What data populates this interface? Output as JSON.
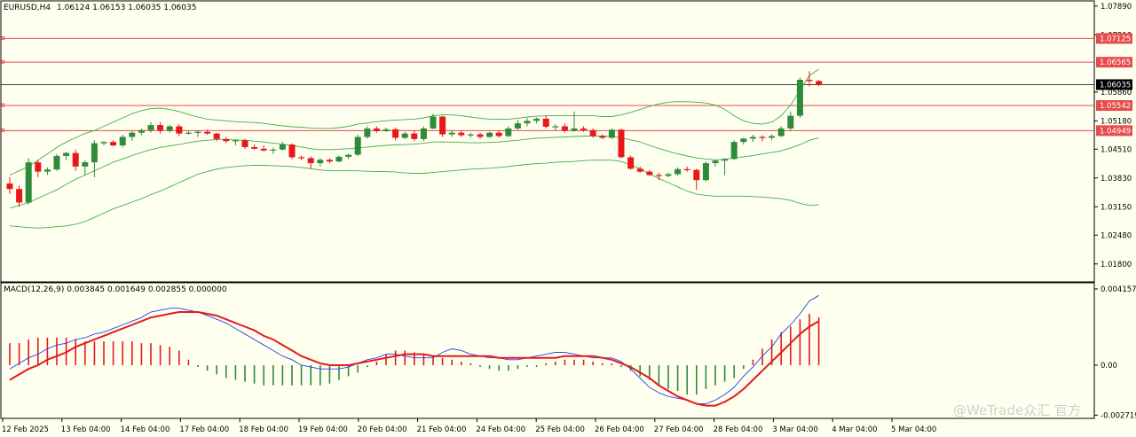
{
  "chart_data": {
    "type": "candlestick",
    "symbol": "EURUSD,H4",
    "ohlc_header": "1.06124 1.06153 1.06035 1.06035",
    "price_axis": {
      "ylim": [
        1.0146,
        1.0795
      ],
      "ticks": [
        "1.07890",
        "1.07210",
        "1.05860",
        "1.05180",
        "1.04510",
        "1.03830",
        "1.03150",
        "1.02480",
        "1.01800"
      ]
    },
    "current_price": "1.06035",
    "levels": [
      {
        "label": "1.07125",
        "value": 1.07125
      },
      {
        "label": "1.06565",
        "value": 1.06565
      },
      {
        "label": "1.05542",
        "value": 1.05542
      },
      {
        "label": "1.04949",
        "value": 1.04949
      }
    ],
    "time_labels": [
      "12 Feb 2025",
      "13 Feb 04:00",
      "14 Feb 04:00",
      "17 Feb 04:00",
      "18 Feb 04:00",
      "19 Feb 04:00",
      "20 Feb 04:00",
      "21 Feb 04:00",
      "24 Feb 04:00",
      "25 Feb 04:00",
      "26 Feb 04:00",
      "27 Feb 04:00",
      "28 Feb 04:00",
      "3 Mar 04:00",
      "4 Mar 04:00",
      "5 Mar 04:00"
    ],
    "candles": [
      [
        1.037,
        1.0385,
        1.0345,
        1.0357
      ],
      [
        1.0357,
        1.0365,
        1.0315,
        1.0325
      ],
      [
        1.0325,
        1.043,
        1.032,
        1.042
      ],
      [
        1.042,
        1.0425,
        1.0385,
        1.0398
      ],
      [
        1.0398,
        1.0408,
        1.039,
        1.0403
      ],
      [
        1.0403,
        1.044,
        1.04,
        1.0435
      ],
      [
        1.0435,
        1.0445,
        1.0425,
        1.0442
      ],
      [
        1.0442,
        1.045,
        1.04,
        1.041
      ],
      [
        1.041,
        1.0425,
        1.039,
        1.042
      ],
      [
        1.042,
        1.0472,
        1.0385,
        1.0465
      ],
      [
        1.0465,
        1.047,
        1.046,
        1.0468
      ],
      [
        1.0468,
        1.0472,
        1.0458,
        1.046
      ],
      [
        1.046,
        1.0485,
        1.0455,
        1.048
      ],
      [
        1.048,
        1.0495,
        1.047,
        1.049
      ],
      [
        1.049,
        1.05,
        1.0484,
        1.0496
      ],
      [
        1.0496,
        1.0515,
        1.049,
        1.0508
      ],
      [
        1.0508,
        1.0515,
        1.0488,
        1.0495
      ],
      [
        1.0495,
        1.0508,
        1.049,
        1.0505
      ],
      [
        1.0505,
        1.051,
        1.0482,
        1.0488
      ],
      [
        1.0488,
        1.0495,
        1.0485,
        1.049
      ],
      [
        1.049,
        1.0496,
        1.048,
        1.0492
      ],
      [
        1.0492,
        1.0497,
        1.0485,
        1.0488
      ],
      [
        1.0488,
        1.049,
        1.047,
        1.0475
      ],
      [
        1.0475,
        1.048,
        1.0465,
        1.047
      ],
      [
        1.047,
        1.0474,
        1.046,
        1.0472
      ],
      [
        1.0472,
        1.0476,
        1.0452,
        1.0456
      ],
      [
        1.0456,
        1.0462,
        1.045,
        1.0452
      ],
      [
        1.0452,
        1.046,
        1.0445,
        1.0448
      ],
      [
        1.0448,
        1.0455,
        1.044,
        1.045
      ],
      [
        1.045,
        1.0468,
        1.0448,
        1.0462
      ],
      [
        1.0462,
        1.0465,
        1.0428,
        1.0432
      ],
      [
        1.0432,
        1.0436,
        1.0425,
        1.043
      ],
      [
        1.043,
        1.0434,
        1.0405,
        1.0418
      ],
      [
        1.0418,
        1.043,
        1.041,
        1.0426
      ],
      [
        1.0426,
        1.043,
        1.0418,
        1.0422
      ],
      [
        1.0422,
        1.0436,
        1.042,
        1.0433
      ],
      [
        1.0433,
        1.044,
        1.0428,
        1.0438
      ],
      [
        1.0438,
        1.0485,
        1.0435,
        1.048
      ],
      [
        1.048,
        1.0505,
        1.0476,
        1.05
      ],
      [
        1.05,
        1.0505,
        1.049,
        1.0494
      ],
      [
        1.0494,
        1.0502,
        1.0492,
        1.0498
      ],
      [
        1.0498,
        1.0502,
        1.0472,
        1.0478
      ],
      [
        1.0478,
        1.0492,
        1.0475,
        1.0488
      ],
      [
        1.0488,
        1.0495,
        1.047,
        1.0475
      ],
      [
        1.0475,
        1.0505,
        1.047,
        1.05
      ],
      [
        1.05,
        1.0535,
        1.0498,
        1.0528
      ],
      [
        1.0528,
        1.053,
        1.048,
        1.0486
      ],
      [
        1.0486,
        1.0496,
        1.048,
        1.049
      ],
      [
        1.049,
        1.0494,
        1.048,
        1.0484
      ],
      [
        1.0484,
        1.049,
        1.0478,
        1.0486
      ],
      [
        1.0486,
        1.049,
        1.0475,
        1.048
      ],
      [
        1.048,
        1.0492,
        1.0478,
        1.049
      ],
      [
        1.049,
        1.0495,
        1.0478,
        1.0482
      ],
      [
        1.0482,
        1.0505,
        1.048,
        1.05
      ],
      [
        1.05,
        1.052,
        1.0496,
        1.0512
      ],
      [
        1.0512,
        1.0525,
        1.0505,
        1.0518
      ],
      [
        1.0518,
        1.0526,
        1.0512,
        1.0523
      ],
      [
        1.0523,
        1.053,
        1.05,
        1.0504
      ],
      [
        1.0504,
        1.051,
        1.0495,
        1.0505
      ],
      [
        1.0505,
        1.0512,
        1.049,
        1.0495
      ],
      [
        1.0495,
        1.054,
        1.0492,
        1.05
      ],
      [
        1.05,
        1.0505,
        1.0492,
        1.0496
      ],
      [
        1.0496,
        1.05,
        1.0478,
        1.0482
      ],
      [
        1.0482,
        1.0486,
        1.0475,
        1.0478
      ],
      [
        1.0478,
        1.05,
        1.0475,
        1.0497
      ],
      [
        1.0497,
        1.05,
        1.043,
        1.0432
      ],
      [
        1.0432,
        1.0436,
        1.0402,
        1.0405
      ],
      [
        1.0405,
        1.041,
        1.0395,
        1.0398
      ],
      [
        1.0398,
        1.0402,
        1.0388,
        1.039
      ],
      [
        1.039,
        1.0395,
        1.0378,
        1.0388
      ],
      [
        1.0388,
        1.0395,
        1.0385,
        1.0392
      ],
      [
        1.0392,
        1.0408,
        1.0388,
        1.0404
      ],
      [
        1.0404,
        1.041,
        1.0398,
        1.0402
      ],
      [
        1.0402,
        1.0405,
        1.0355,
        1.0378
      ],
      [
        1.0378,
        1.0422,
        1.0375,
        1.0418
      ],
      [
        1.0418,
        1.0425,
        1.041,
        1.0424
      ],
      [
        1.0424,
        1.043,
        1.039,
        1.0428
      ],
      [
        1.0428,
        1.0472,
        1.0425,
        1.0468
      ],
      [
        1.0468,
        1.0478,
        1.0462,
        1.0476
      ],
      [
        1.0476,
        1.0485,
        1.0468,
        1.048
      ],
      [
        1.048,
        1.0484,
        1.047,
        1.0478
      ],
      [
        1.0478,
        1.0486,
        1.0472,
        1.0482
      ],
      [
        1.0482,
        1.0505,
        1.048,
        1.05
      ],
      [
        1.05,
        1.054,
        1.0495,
        1.053
      ],
      [
        1.053,
        1.062,
        1.0525,
        1.0615
      ],
      [
        1.0615,
        1.0635,
        1.06,
        1.0612
      ],
      [
        1.0612,
        1.0615,
        1.06,
        1.0603
      ]
    ],
    "bollinger": {
      "upper": [
        1.039,
        1.04,
        1.041,
        1.0425,
        1.044,
        1.0455,
        1.0468,
        1.0478,
        1.0488,
        1.0495,
        1.0505,
        1.0515,
        1.0525,
        1.0535,
        1.0542,
        1.0547,
        1.0548,
        1.0545,
        1.054,
        1.0533,
        1.0527,
        1.0522,
        1.052,
        1.0518,
        1.0516,
        1.0515,
        1.0514,
        1.0512,
        1.0509,
        1.0506,
        1.0504,
        1.0503,
        1.0501,
        1.05,
        1.05,
        1.0502,
        1.0505,
        1.051,
        1.0513,
        1.0516,
        1.0518,
        1.052,
        1.0521,
        1.0522,
        1.0525,
        1.053,
        1.0532,
        1.0532,
        1.053,
        1.0527,
        1.0524,
        1.0522,
        1.0522,
        1.0522,
        1.0524,
        1.0527,
        1.0529,
        1.053,
        1.053,
        1.053,
        1.053,
        1.053,
        1.053,
        1.0528,
        1.0528,
        1.0532,
        1.0538,
        1.0545,
        1.0552,
        1.0558,
        1.0562,
        1.0563,
        1.0563,
        1.0562,
        1.056,
        1.0555,
        1.0545,
        1.053,
        1.0518,
        1.0512,
        1.051,
        1.0515,
        1.053,
        1.0555,
        1.059,
        1.0625,
        1.064
      ],
      "middle": [
        1.0312,
        1.0318,
        1.0325,
        1.0335,
        1.0345,
        1.0355,
        1.0368,
        1.038,
        1.039,
        1.04,
        1.041,
        1.042,
        1.0428,
        1.0436,
        1.0443,
        1.045,
        1.0455,
        1.0459,
        1.0462,
        1.0466,
        1.047,
        1.0472,
        1.0474,
        1.0474,
        1.0473,
        1.0472,
        1.047,
        1.0468,
        1.0465,
        1.0463,
        1.046,
        1.0456,
        1.0452,
        1.045,
        1.045,
        1.0451,
        1.0452,
        1.0454,
        1.0456,
        1.0458,
        1.046,
        1.0461,
        1.0462,
        1.0463,
        1.0465,
        1.0468,
        1.0468,
        1.0468,
        1.0467,
        1.0466,
        1.0466,
        1.0467,
        1.0468,
        1.047,
        1.0472,
        1.0475,
        1.0477,
        1.0478,
        1.0479,
        1.048,
        1.0481,
        1.0482,
        1.0482,
        1.0482,
        1.0481,
        1.0478,
        1.0473,
        1.0468,
        1.046,
        1.0453,
        1.0446,
        1.044,
        1.0435,
        1.043,
        1.0428,
        1.0426,
        1.0427,
        1.043,
        1.0433,
        1.0436,
        1.044,
        1.0443,
        1.0447,
        1.0454,
        1.0462,
        1.0472,
        1.0478
      ],
      "lower": [
        1.027,
        1.0268,
        1.0266,
        1.0265,
        1.0266,
        1.0268,
        1.027,
        1.0274,
        1.028,
        1.029,
        1.03,
        1.031,
        1.0318,
        1.0326,
        1.0334,
        1.0344,
        1.0352,
        1.0362,
        1.0372,
        1.0382,
        1.0392,
        1.0398,
        1.0404,
        1.0408,
        1.041,
        1.0412,
        1.0413,
        1.0413,
        1.0412,
        1.0411,
        1.041,
        1.0408,
        1.0405,
        1.0402,
        1.04,
        1.04,
        1.04,
        1.04,
        1.0399,
        1.0398,
        1.0398,
        1.0397,
        1.0395,
        1.0394,
        1.0394,
        1.0396,
        1.0398,
        1.04,
        1.0402,
        1.0404,
        1.0405,
        1.0406,
        1.0408,
        1.041,
        1.0413,
        1.0415,
        1.0417,
        1.0418,
        1.042,
        1.0421,
        1.0422,
        1.0424,
        1.0425,
        1.0425,
        1.0425,
        1.0422,
        1.0414,
        1.0405,
        1.0393,
        1.0382,
        1.0372,
        1.0362,
        1.0352,
        1.0345,
        1.0342,
        1.034,
        1.034,
        1.034,
        1.034,
        1.0339,
        1.0338,
        1.0336,
        1.0334,
        1.033,
        1.0323,
        1.0318,
        1.032
      ]
    },
    "macd": {
      "label": "MACD(12,26,9) 0.003845 0.001649 0.002855 0.000000",
      "ylim": [
        -0.0028,
        0.00425
      ],
      "ticks": [
        "0.004157",
        "0.00",
        "-0.002719"
      ],
      "histogram": [
        0.0012,
        0.0012,
        0.0014,
        0.0015,
        0.0015,
        0.0015,
        0.0015,
        0.0014,
        0.0013,
        0.0013,
        0.0013,
        0.0013,
        0.0013,
        0.0013,
        0.0012,
        0.0012,
        0.0011,
        0.001,
        0.0008,
        0.0003,
        -0.0001,
        -0.0003,
        -0.0005,
        -0.0007,
        -0.0008,
        -0.0009,
        -0.001,
        -0.0011,
        -0.0011,
        -0.0011,
        -0.0011,
        -0.0011,
        -0.0011,
        -0.0011,
        -0.001,
        -0.0008,
        -0.0006,
        -0.0004,
        -0.0001,
        0.0002,
        0.0006,
        0.0008,
        0.0008,
        0.0007,
        0.0006,
        0.0005,
        0.0004,
        0.0003,
        0.0002,
        0.0001,
        -0.0001,
        -0.0002,
        -0.0003,
        -0.0003,
        -0.0002,
        -0.0001,
        -0.0001,
        0.0001,
        0.0002,
        0.0003,
        0.0003,
        0.0003,
        0.0002,
        0.0001,
        0.0001,
        -0.0001,
        -0.0003,
        -0.0006,
        -0.0008,
        -0.0011,
        -0.0013,
        -0.0014,
        -0.0016,
        -0.0016,
        -0.0013,
        -0.0011,
        -0.0009,
        -0.0007,
        -0.0002,
        0.0003,
        0.0009,
        0.0014,
        0.0018,
        0.0021,
        0.0025,
        0.0028,
        0.0026
      ],
      "macd_line": [
        -0.0002,
        0.0001,
        0.0004,
        0.0006,
        0.0009,
        0.0011,
        0.0012,
        0.0014,
        0.0015,
        0.0017,
        0.0018,
        0.002,
        0.0022,
        0.0024,
        0.0026,
        0.0029,
        0.003,
        0.0031,
        0.0031,
        0.003,
        0.0029,
        0.0027,
        0.0025,
        0.0023,
        0.002,
        0.0017,
        0.0014,
        0.0011,
        0.0008,
        0.0005,
        0.0003,
        0.0,
        -0.0001,
        -0.0002,
        -0.0002,
        -0.0002,
        -0.0001,
        0.0001,
        0.0003,
        0.0004,
        0.0006,
        0.0006,
        0.0005,
        0.0004,
        0.0004,
        0.0004,
        0.0007,
        0.0009,
        0.0008,
        0.0006,
        0.0005,
        0.0004,
        0.0004,
        0.0003,
        0.0003,
        0.0004,
        0.0005,
        0.0006,
        0.0007,
        0.0007,
        0.0006,
        0.0005,
        0.0004,
        0.0004,
        0.0004,
        0.0002,
        -0.0002,
        -0.0007,
        -0.0012,
        -0.0015,
        -0.0017,
        -0.0018,
        -0.0019,
        -0.0021,
        -0.0021,
        -0.0019,
        -0.0016,
        -0.0012,
        -0.0006,
        -0.0001,
        0.0005,
        0.001,
        0.0017,
        0.0022,
        0.0028,
        0.0035,
        0.0038
      ],
      "signal_line": [
        -0.0008,
        -0.0005,
        -0.0002,
        0.0,
        0.0003,
        0.0005,
        0.0007,
        0.001,
        0.0012,
        0.0014,
        0.0016,
        0.0018,
        0.002,
        0.0022,
        0.0024,
        0.0026,
        0.0027,
        0.0028,
        0.0029,
        0.0029,
        0.0029,
        0.0028,
        0.0027,
        0.0025,
        0.0023,
        0.0021,
        0.0019,
        0.0016,
        0.0014,
        0.0011,
        0.0008,
        0.0005,
        0.0003,
        0.0001,
        0.0,
        -0.0,
        0.0,
        0.0001,
        0.0002,
        0.0003,
        0.0004,
        0.0005,
        0.0006,
        0.0006,
        0.0006,
        0.0005,
        0.0005,
        0.0005,
        0.0005,
        0.0005,
        0.0005,
        0.0005,
        0.0004,
        0.0004,
        0.0004,
        0.0004,
        0.0004,
        0.0004,
        0.0004,
        0.0005,
        0.0005,
        0.0005,
        0.0005,
        0.0004,
        0.0003,
        0.0001,
        -0.0001,
        -0.0004,
        -0.0007,
        -0.0011,
        -0.0014,
        -0.0017,
        -0.0019,
        -0.0021,
        -0.0022,
        -0.0022,
        -0.002,
        -0.0017,
        -0.0013,
        -0.0008,
        -0.0003,
        0.0002,
        0.0007,
        0.0012,
        0.0017,
        0.0021,
        0.0024
      ]
    },
    "colors": {
      "background": "#fffff0",
      "bull": "#2e8b3a",
      "bear": "#e81818",
      "band": "#3fae49",
      "level_line": "#e74c4c",
      "macd_line": "#2a3fe8",
      "signal_line": "#e21b1b"
    }
  },
  "watermark": "@WeTrade众汇 官方"
}
